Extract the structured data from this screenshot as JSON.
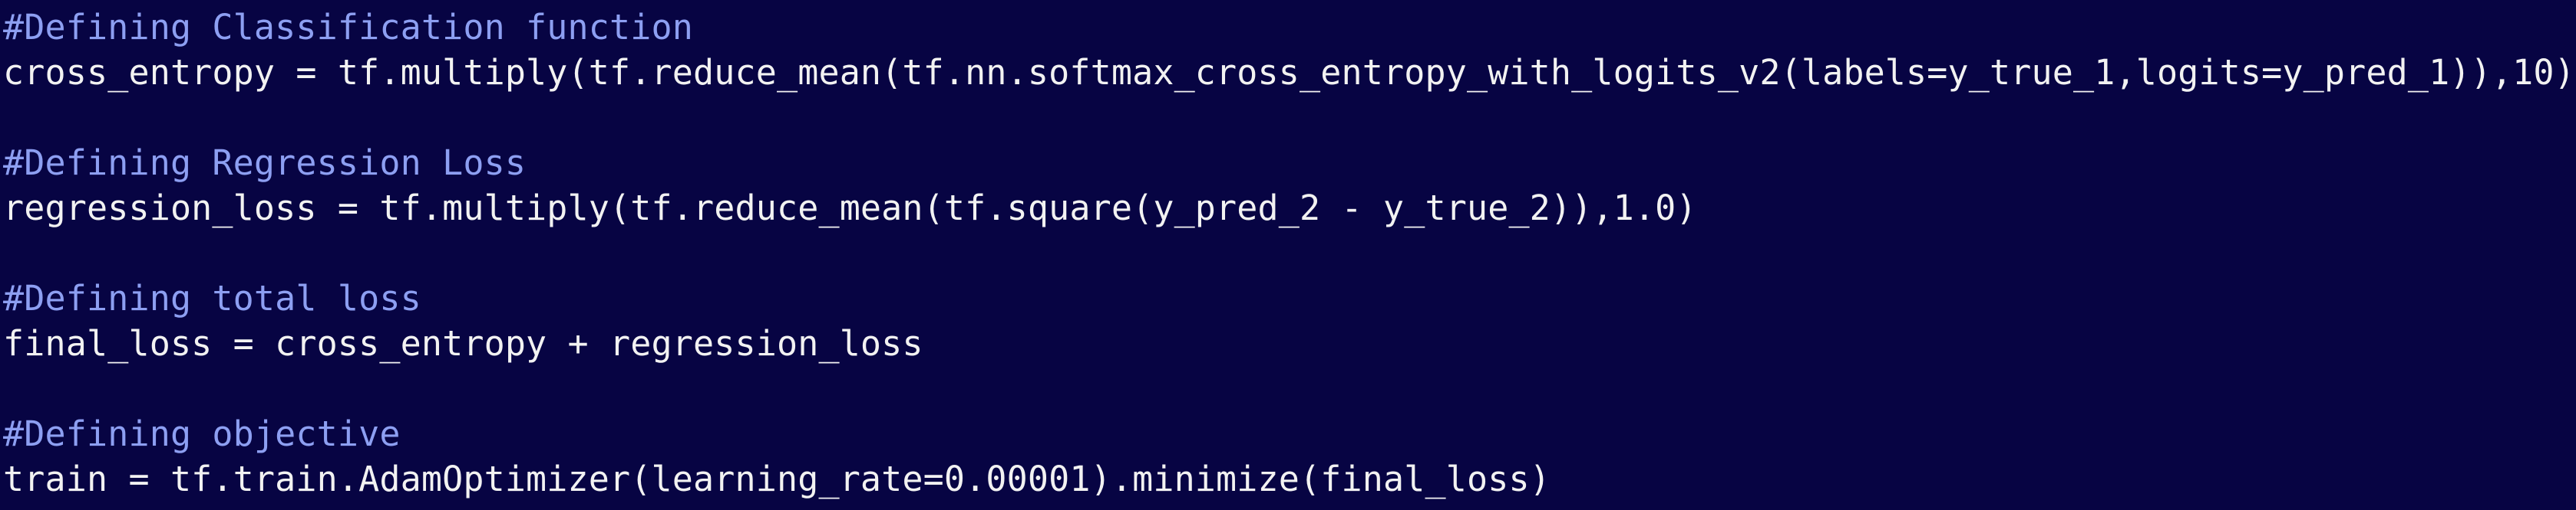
{
  "colors": {
    "background": "#070443",
    "comment": "#8d9ff2",
    "code": "#f2f2f2"
  },
  "code_lines": [
    {
      "kind": "comment",
      "text": "#Defining Classification function"
    },
    {
      "kind": "code",
      "text": "cross_entropy = tf.multiply(tf.reduce_mean(tf.nn.softmax_cross_entropy_with_logits_v2(labels=y_true_1,logits=y_pred_1)),10)"
    },
    {
      "kind": "blank",
      "text": ""
    },
    {
      "kind": "comment",
      "text": "#Defining Regression Loss"
    },
    {
      "kind": "code",
      "text": "regression_loss = tf.multiply(tf.reduce_mean(tf.square(y_pred_2 - y_true_2)),1.0)"
    },
    {
      "kind": "blank",
      "text": ""
    },
    {
      "kind": "comment",
      "text": "#Defining total loss"
    },
    {
      "kind": "code",
      "text": "final_loss = cross_entropy + regression_loss"
    },
    {
      "kind": "blank",
      "text": ""
    },
    {
      "kind": "comment",
      "text": "#Defining objective"
    },
    {
      "kind": "code",
      "text": "train = tf.train.AdamOptimizer(learning_rate=0.00001).minimize(final_loss)"
    }
  ]
}
